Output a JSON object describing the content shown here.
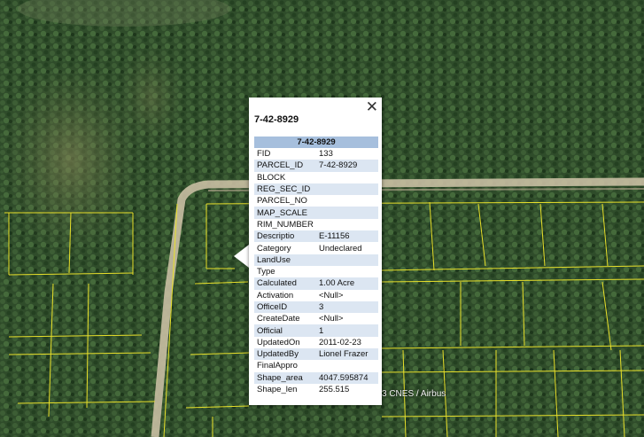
{
  "attribution": "3 CNES / Airbus",
  "popup": {
    "close_glyph": "✕",
    "title": "7-42-8929",
    "table_header": "7-42-8929",
    "rows": [
      {
        "key": "FID",
        "value": "133"
      },
      {
        "key": "PARCEL_ID",
        "value": "7-42-8929"
      },
      {
        "key": "BLOCK",
        "value": ""
      },
      {
        "key": "REG_SEC_ID",
        "value": ""
      },
      {
        "key": "PARCEL_NO",
        "value": ""
      },
      {
        "key": "MAP_SCALE",
        "value": ""
      },
      {
        "key": "RIM_NUMBER",
        "value": ""
      },
      {
        "key": "Descriptio",
        "value": "E-11156"
      },
      {
        "key": "Category",
        "value": "Undeclared"
      },
      {
        "key": "LandUse",
        "value": ""
      },
      {
        "key": "Type",
        "value": ""
      },
      {
        "key": "Calculated",
        "value": "1.00 Acre"
      },
      {
        "key": "Activation",
        "value": "<Null>"
      },
      {
        "key": "OfficeID",
        "value": "3"
      },
      {
        "key": "CreateDate",
        "value": "<Null>"
      },
      {
        "key": "Official",
        "value": "1"
      },
      {
        "key": "UpdatedOn",
        "value": "2011-02-23"
      },
      {
        "key": "UpdatedBy",
        "value": "Lionel Frazer"
      },
      {
        "key": "FinalAppro",
        "value": ""
      },
      {
        "key": "Shape_area",
        "value": "4047.595874"
      },
      {
        "key": "Shape_len",
        "value": "255.515"
      }
    ]
  },
  "colors": {
    "parcel_line": "#e8e02a",
    "vegetation": "#2d4a27",
    "road": "#c9bfa3",
    "table_header_bg": "#a6bfdd",
    "row_alt_bg": "#dce6f2"
  }
}
